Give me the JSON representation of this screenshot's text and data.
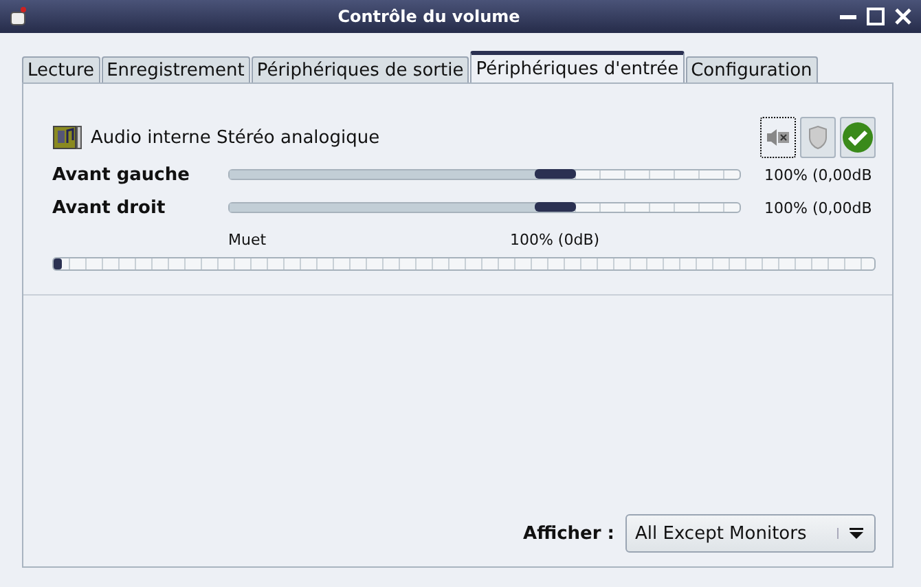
{
  "window": {
    "title": "Contrôle du volume"
  },
  "tabs": [
    {
      "label": "Lecture",
      "selected": false
    },
    {
      "label": "Enregistrement",
      "selected": false
    },
    {
      "label": "Périphériques de sortie",
      "selected": false
    },
    {
      "label": "Périphériques d'entrée",
      "selected": true
    },
    {
      "label": "Configuration",
      "selected": false
    }
  ],
  "device": {
    "name": "Audio interne Stéréo analogique",
    "channels": [
      {
        "name": "Avant gauche",
        "level": 0.64,
        "reading": "100% (0,00dB"
      },
      {
        "name": "Avant droit",
        "level": 0.64,
        "reading": "100% (0,00dB"
      }
    ],
    "scale": {
      "low": "Muet",
      "mid": "100% (0dB)"
    },
    "meter": {
      "level": 0.01
    }
  },
  "filter": {
    "label": "Afficher :",
    "value": "All Except Monitors"
  }
}
